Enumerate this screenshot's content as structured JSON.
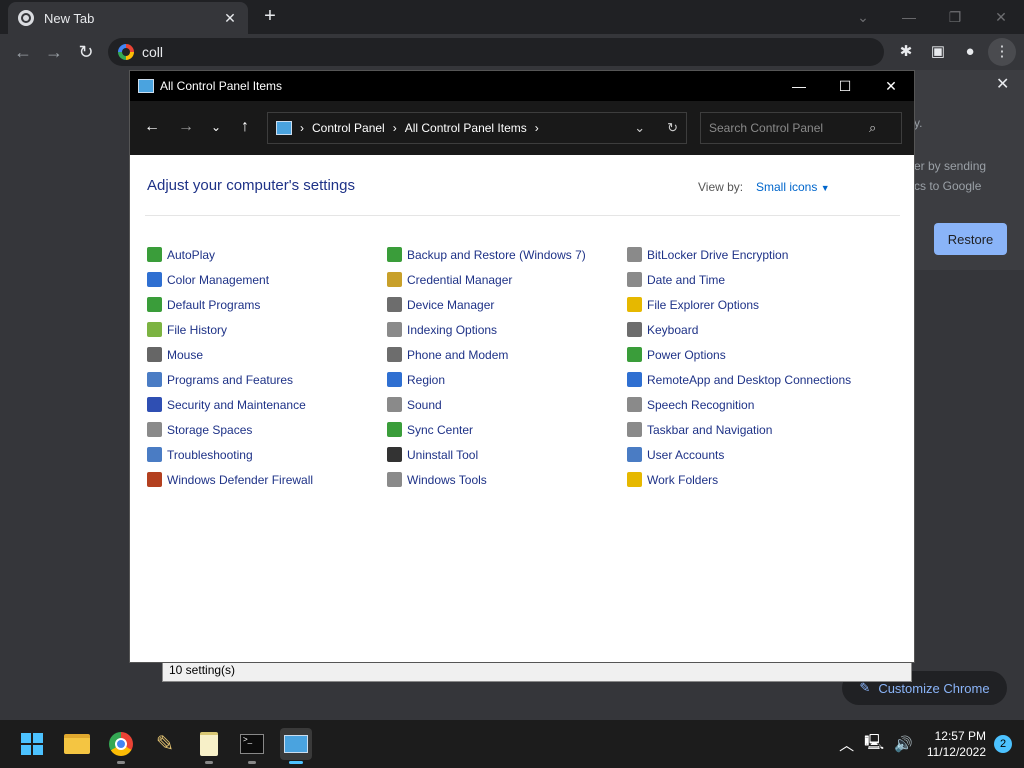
{
  "chrome": {
    "tab_title": "New Tab",
    "tab_close": "✕",
    "new_tab": "+",
    "omnibox_value": "coll",
    "side_card_text_1": "er by sending",
    "side_card_text_2": "cs to Google",
    "side_card_dot": "y.",
    "restore_label": "Restore",
    "customize_label": "Customize Chrome"
  },
  "window": {
    "title": "All Control Panel Items",
    "minimize": "—",
    "maximize": "☐",
    "close": "✕"
  },
  "address": {
    "crumbs": [
      "Control Panel",
      "All Control Panel Items"
    ],
    "search_placeholder": "Search Control Panel"
  },
  "content": {
    "heading": "Adjust your computer's settings",
    "view_by_label": "View by:",
    "view_by_value": "Small icons"
  },
  "items": {
    "col1": [
      {
        "label": "AutoPlay",
        "color": "#3a9d3a"
      },
      {
        "label": "Color Management",
        "color": "#2f6fd1"
      },
      {
        "label": "Default Programs",
        "color": "#3a9d3a"
      },
      {
        "label": "File History",
        "color": "#7cb342"
      },
      {
        "label": "Mouse",
        "color": "#666666"
      },
      {
        "label": "Programs and Features",
        "color": "#4a7cc4"
      },
      {
        "label": "Security and Maintenance",
        "color": "#2f4fb3"
      },
      {
        "label": "Storage Spaces",
        "color": "#8a8a8a"
      },
      {
        "label": "Troubleshooting",
        "color": "#4a7cc4"
      },
      {
        "label": "Windows Defender Firewall",
        "color": "#b3401f"
      }
    ],
    "col2": [
      {
        "label": "Backup and Restore (Windows 7)",
        "color": "#3a9d3a"
      },
      {
        "label": "Credential Manager",
        "color": "#c8a02a"
      },
      {
        "label": "Device Manager",
        "color": "#6d6d6d"
      },
      {
        "label": "Indexing Options",
        "color": "#8a8a8a"
      },
      {
        "label": "Phone and Modem",
        "color": "#6d6d6d"
      },
      {
        "label": "Region",
        "color": "#2f6fd1"
      },
      {
        "label": "Sound",
        "color": "#8a8a8a"
      },
      {
        "label": "Sync Center",
        "color": "#3a9d3a"
      },
      {
        "label": "Uninstall Tool",
        "color": "#333333"
      },
      {
        "label": "Windows Tools",
        "color": "#8a8a8a"
      }
    ],
    "col3": [
      {
        "label": "BitLocker Drive Encryption",
        "color": "#8a8a8a"
      },
      {
        "label": "Date and Time",
        "color": "#8a8a8a"
      },
      {
        "label": "File Explorer Options",
        "color": "#e6b800"
      },
      {
        "label": "Keyboard",
        "color": "#6d6d6d"
      },
      {
        "label": "Power Options",
        "color": "#3a9d3a"
      },
      {
        "label": "RemoteApp and Desktop Connections",
        "color": "#2f6fd1"
      },
      {
        "label": "Speech Recognition",
        "color": "#8a8a8a"
      },
      {
        "label": "Taskbar and Navigation",
        "color": "#8a8a8a"
      },
      {
        "label": "User Accounts",
        "color": "#4a7cc4"
      },
      {
        "label": "Work Folders",
        "color": "#e6b800"
      }
    ]
  },
  "status": {
    "text": "10 setting(s)"
  },
  "taskbar": {
    "time": "12:57 PM",
    "date": "11/12/2022",
    "notifications": "2"
  }
}
